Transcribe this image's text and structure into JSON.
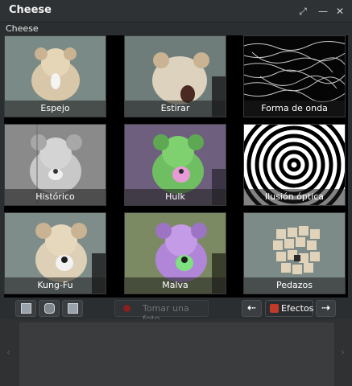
{
  "window": {
    "title": "Cheese"
  },
  "menubar": {
    "item": "Cheese"
  },
  "effects_grid": [
    {
      "label": "Espejo"
    },
    {
      "label": "Estirar"
    },
    {
      "label": "Forma de onda"
    },
    {
      "label": "Histórico"
    },
    {
      "label": "Hulk"
    },
    {
      "label": "Ilusión óptica"
    },
    {
      "label": "Kung-Fu"
    },
    {
      "label": "Malva"
    },
    {
      "label": "Pedazos"
    }
  ],
  "toolbar": {
    "take_photo": "Tomar una foto",
    "effects": "Efectos",
    "prev_icon": "arrow-left-icon",
    "next_icon": "arrow-right-icon"
  },
  "colors": {
    "bg": "#2b2e30",
    "grid_bg": "#000000",
    "record_dot": "#8b1e1e",
    "effects_icon": "#c0392b"
  }
}
